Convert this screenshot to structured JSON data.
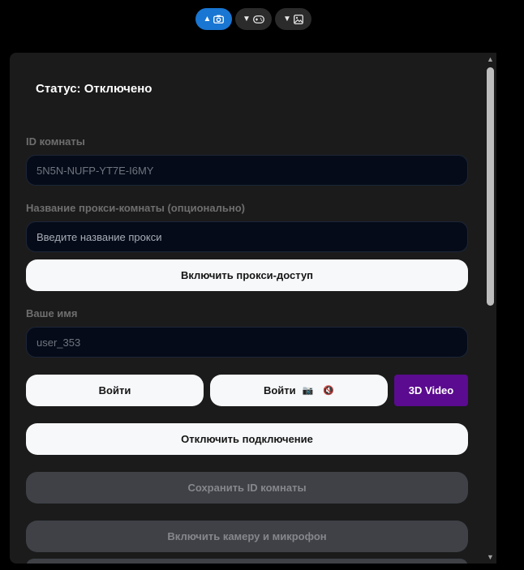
{
  "toolbar": {
    "buttons": [
      {
        "arrow": "▲",
        "icon": "camera-icon",
        "active": true
      },
      {
        "arrow": "▼",
        "icon": "gamepad-icon",
        "active": false
      },
      {
        "arrow": "▼",
        "icon": "image-icon",
        "active": false
      }
    ]
  },
  "status": {
    "text": "Статус: Отключено"
  },
  "room": {
    "label": "ID комнаты",
    "value": "5N5N-NUFP-YT7E-I6MY"
  },
  "proxy": {
    "label": "Название прокси-комнаты (опционально)",
    "placeholder": "Введите название прокси",
    "enable_label": "Включить прокси-доступ"
  },
  "user": {
    "label": "Ваше имя",
    "value": "user_353"
  },
  "actions": {
    "join_label": "Войти",
    "join_media_label": "Войти",
    "join_media_icons": [
      "📷",
      "🔇"
    ],
    "video3d_label": "3D Video",
    "disconnect_label": "Отключить подключение",
    "save_room_label": "Сохранить ID комнаты",
    "enable_media_label": "Включить камеру и микрофон"
  },
  "colors": {
    "accent": "#1976d2",
    "purple": "#5a0b8f",
    "panel": "#1b1b1b",
    "field": "#050b18"
  }
}
